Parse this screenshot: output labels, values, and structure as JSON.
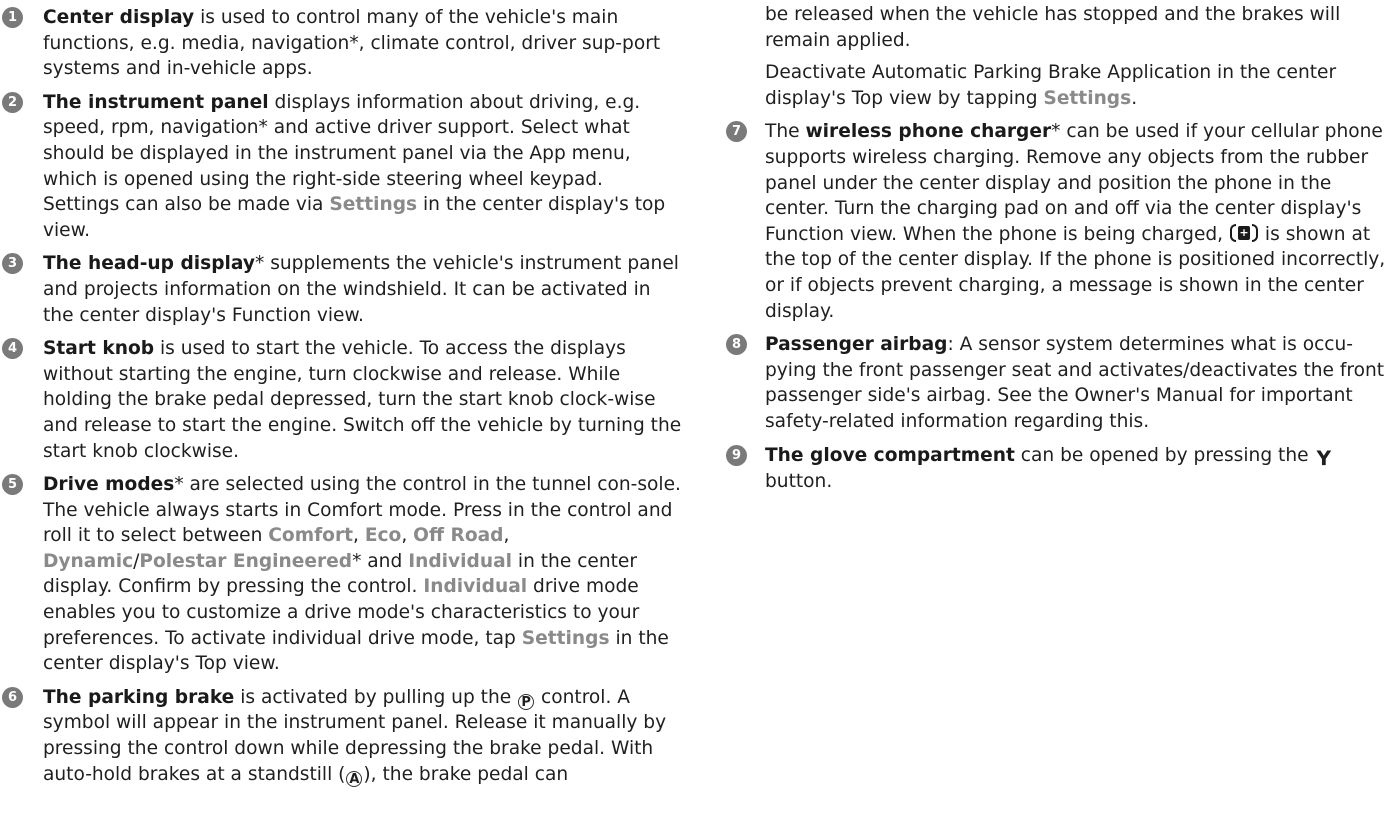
{
  "items": [
    {
      "num": "1",
      "bold": "Center display",
      "rest": " is used to control many of the vehicle's main functions, e.g. media, navigation*, climate control, driver sup-port systems and in-vehicle apps."
    },
    {
      "num": "2",
      "bold": "The instrument panel",
      "rest": " displays information about driving, e.g. speed, rpm, navigation* and active driver support. Select what should be displayed in the instrument panel via the App menu, which is opened using the right-side steering wheel keypad. Settings can also be made via ",
      "ui": "Settings",
      "end": " in the center display's top view."
    },
    {
      "num": "3",
      "bold": "The head-up display",
      "rest": "* supplements the vehicle's instrument panel and projects information on the windshield. It can be activated in the center display's Function view."
    },
    {
      "num": "4",
      "bold": "Start knob",
      "rest": " is used to start the vehicle. To access the displays without starting the engine, turn clockwise and release. While holding the brake pedal depressed, turn the start knob clock-wise and release to start the engine. Switch off the vehicle by turning the start knob clockwise."
    },
    {
      "num": "5",
      "bold": "Drive modes",
      "t1": "* are selected using the control in the tunnel con-sole. The vehicle always starts in Comfort mode. Press in the control and roll it to select between ",
      "comfort": "Comfort",
      "sep1": ", ",
      "eco": "Eco",
      "sep2": ", ",
      "offroad": "Off Road",
      "sep3": ", ",
      "dynamic": "Dynamic",
      "slash": "/",
      "polestar": "Polestar Engineered",
      "t2": "* and ",
      "individual": "Individual",
      "t3": " in the center display. Confirm by pressing the control. ",
      "individual2": "Individual",
      "t4": " drive mode enables you to customize a drive mode's characteristics to your preferences. To activate individual drive mode, tap ",
      "settings": "Settings",
      "t5": " in the center display's Top view."
    },
    {
      "num": "6",
      "bold": "The parking brake",
      "t1": " is activated by pulling up the ",
      "sym_p": "P",
      "t2": " control. A symbol will appear in the instrument panel. Release it manually by pressing the control down while depressing the brake pedal. With auto-hold brakes at a standstill (",
      "sym_a": "A",
      "t3": "), the brake pedal can",
      "cont1": "be released when the vehicle has stopped and the brakes will remain applied.",
      "cont2a": "Deactivate Automatic Parking Brake Application in the center display's Top view by tapping ",
      "cont2ui": "Settings",
      "cont2b": "."
    },
    {
      "num": "7",
      "pre": "The ",
      "bold": "wireless phone charger",
      "t1": "* can be used if your cellular phone supports wireless charging. Remove any objects from the rubber panel under the center display and position the phone in the center. Turn the charging pad on and off via the center display's Function view. When the phone is being charged, ",
      "t2": " is shown at the top of the center display. If the phone is positioned incorrectly, or if objects prevent charging, a message is shown in the center display."
    },
    {
      "num": "8",
      "bold": "Passenger airbag",
      "rest": ": A sensor system determines what is occu-pying the front passenger seat and activates/deactivates the front passenger side's airbag. See the Owner's Manual for important safety-related information regarding this."
    },
    {
      "num": "9",
      "bold": "The glove compartment",
      "t1": " can be opened by pressing the ",
      "t2": " button."
    }
  ],
  "icons": {
    "parking_brake": "parking-brake-icon",
    "auto_hold": "auto-hold-icon",
    "wireless_charging": "wireless-charging-icon",
    "glove_box": "glove-box-button-icon"
  },
  "colors": {
    "number_badge": "#7a7a7a",
    "ui_highlight": "#8a8a8a",
    "text": "#1f1f1f"
  }
}
